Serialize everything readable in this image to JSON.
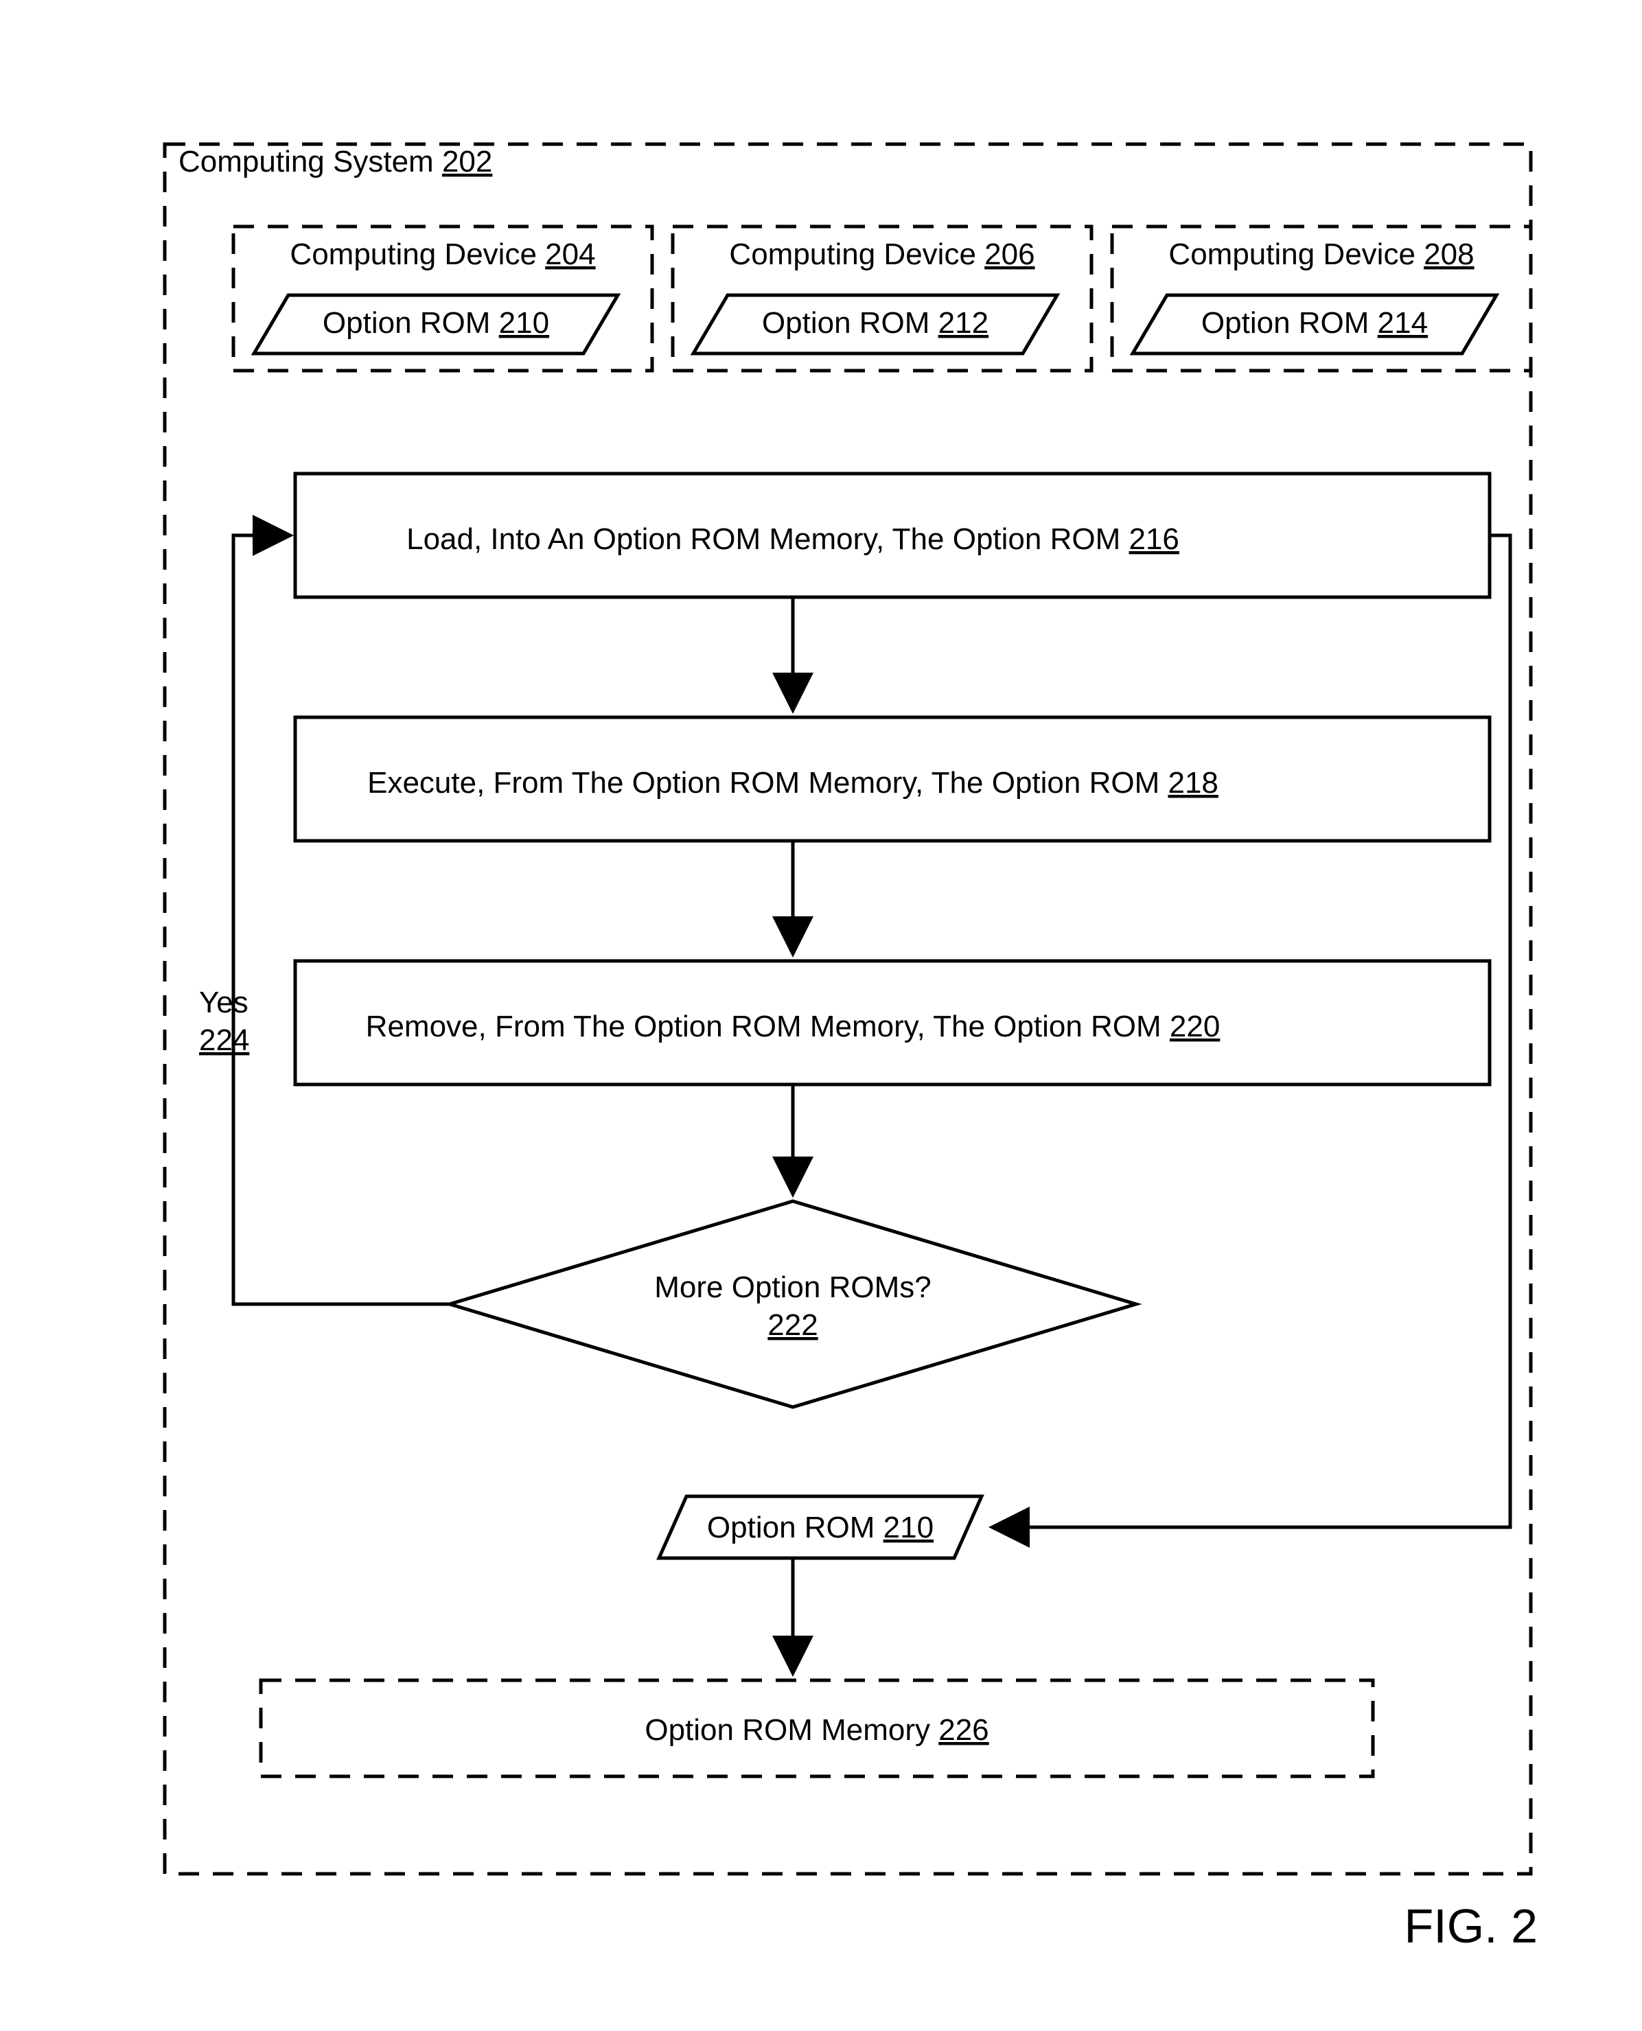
{
  "container": {
    "label": "Computing System",
    "ref": "202"
  },
  "devices": [
    {
      "label": "Computing Device",
      "ref": "204",
      "rom_label": "Option ROM",
      "rom_ref": "210"
    },
    {
      "label": "Computing Device",
      "ref": "206",
      "rom_label": "Option ROM",
      "rom_ref": "212"
    },
    {
      "label": "Computing Device",
      "ref": "208",
      "rom_label": "Option ROM",
      "rom_ref": "214"
    }
  ],
  "steps": {
    "load": {
      "text": "Load, Into An Option ROM Memory, The Option ROM",
      "ref": "216"
    },
    "execute": {
      "text": "Execute, From The Option ROM Memory, The Option ROM",
      "ref": "218"
    },
    "remove": {
      "text": "Remove, From The Option ROM Memory, The Option ROM",
      "ref": "220"
    }
  },
  "decision": {
    "text": "More Option ROMs?",
    "ref": "222"
  },
  "yes": {
    "text": "Yes",
    "ref": "224"
  },
  "rom_out": {
    "text": "Option ROM",
    "ref": "210"
  },
  "rom_memory": {
    "text": "Option ROM Memory",
    "ref": "226"
  },
  "figure": "FIG. 2"
}
